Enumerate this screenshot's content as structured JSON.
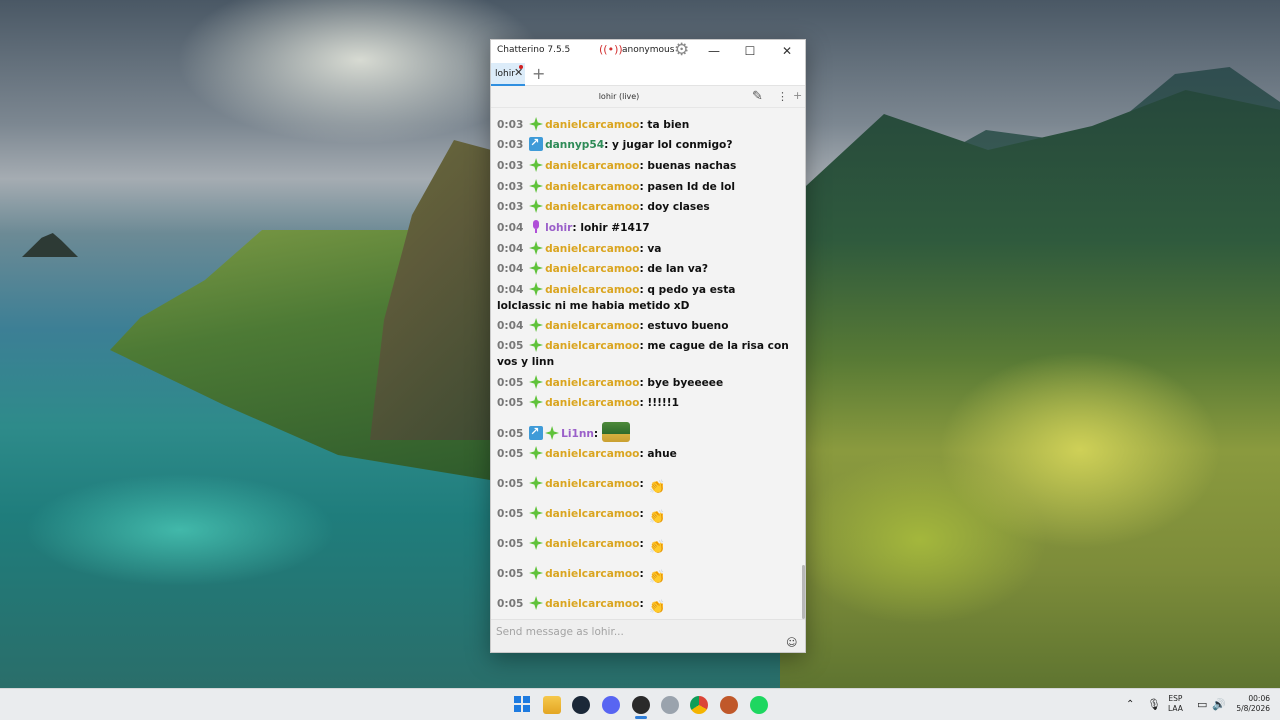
{
  "window": {
    "title": "Chatterino 7.5.5",
    "user": "anonymous",
    "minimize": "—",
    "maximize": "☐",
    "close": "✕"
  },
  "tabs": [
    {
      "label": "lohir",
      "close": "✕"
    }
  ],
  "add_tab": "+",
  "split": {
    "channel": "lohir (live)",
    "edit_glyph": "✎",
    "menu_glyph": "⋮",
    "add_glyph": "+"
  },
  "messages": [
    {
      "time": "0:03",
      "user": "danielcarcamoo",
      "text": "ta bien"
    },
    {
      "time": "0:03",
      "user": "dannyp54",
      "text": "y jugar lol conmigo?"
    },
    {
      "time": "0:03",
      "user": "danielcarcamoo",
      "text": "buenas nachas"
    },
    {
      "time": "0:03",
      "user": "danielcarcamoo",
      "text": "pasen Id de lol"
    },
    {
      "time": "0:03",
      "user": "danielcarcamoo",
      "text": "doy clases"
    },
    {
      "time": "0:04",
      "user": "lohir",
      "text": "lohir #1417"
    },
    {
      "time": "0:04",
      "user": "danielcarcamoo",
      "text": "va"
    },
    {
      "time": "0:04",
      "user": "danielcarcamoo",
      "text": "de lan va?"
    },
    {
      "time": "0:04",
      "user": "danielcarcamoo",
      "text": "q pedo ya esta lolclassic ni me habia metido xD"
    },
    {
      "time": "0:04",
      "user": "danielcarcamoo",
      "text": "estuvo bueno"
    },
    {
      "time": "0:05",
      "user": "danielcarcamoo",
      "text": "me cague de la risa con vos y linn"
    },
    {
      "time": "0:05",
      "user": "danielcarcamoo",
      "text": "bye byeeeee"
    },
    {
      "time": "0:05",
      "user": "danielcarcamoo",
      "text": "!!!!!1"
    },
    {
      "time": "0:05",
      "user": "Li1nn",
      "text": ""
    },
    {
      "time": "0:05",
      "user": "danielcarcamoo",
      "text": "ahue"
    },
    {
      "time": "0:05",
      "user": "danielcarcamoo",
      "text": ""
    },
    {
      "time": "0:05",
      "user": "danielcarcamoo",
      "text": ""
    },
    {
      "time": "0:05",
      "user": "danielcarcamoo",
      "text": ""
    },
    {
      "time": "0:05",
      "user": "danielcarcamoo",
      "text": ""
    },
    {
      "time": "0:05",
      "user": "danielcarcamoo",
      "text": ""
    }
  ],
  "input": {
    "placeholder": "Send message as lohir..."
  },
  "tray": {
    "lang_top": "ESP",
    "lang_bottom": "LAA",
    "time": "00:06",
    "date": "5/8/2026"
  },
  "colors": {
    "accent": "#2f8fe0",
    "username_gold": "#daa520",
    "username_green": "#2e8b57",
    "username_purple": "#9a5fc9"
  }
}
